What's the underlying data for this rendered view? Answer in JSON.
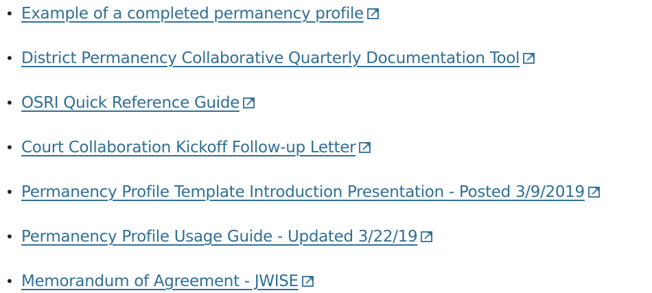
{
  "links": [
    {
      "label": "Example of a completed permanency profile ",
      "icon": "external-link-icon"
    },
    {
      "label": "District Permanency Collaborative Quarterly Documentation Tool",
      "icon": "external-link-icon"
    },
    {
      "label": "OSRI Quick Reference Guide",
      "icon": "external-link-icon"
    },
    {
      "label": "Court Collaboration Kickoff Follow-up Letter",
      "icon": "external-link-icon"
    },
    {
      "label": "Permanency Profile Template Introduction Presentation - Posted 3/9/2019",
      "icon": "external-link-icon"
    },
    {
      "label": "Permanency Profile Usage Guide - Updated 3/22/19",
      "icon": "external-link-icon"
    },
    {
      "label": "Memorandum of Agreement - JWISE",
      "icon": "external-link-icon"
    }
  ],
  "colors": {
    "link": "#2f6f95",
    "bullet": "#222222",
    "background": "#ffffff"
  }
}
